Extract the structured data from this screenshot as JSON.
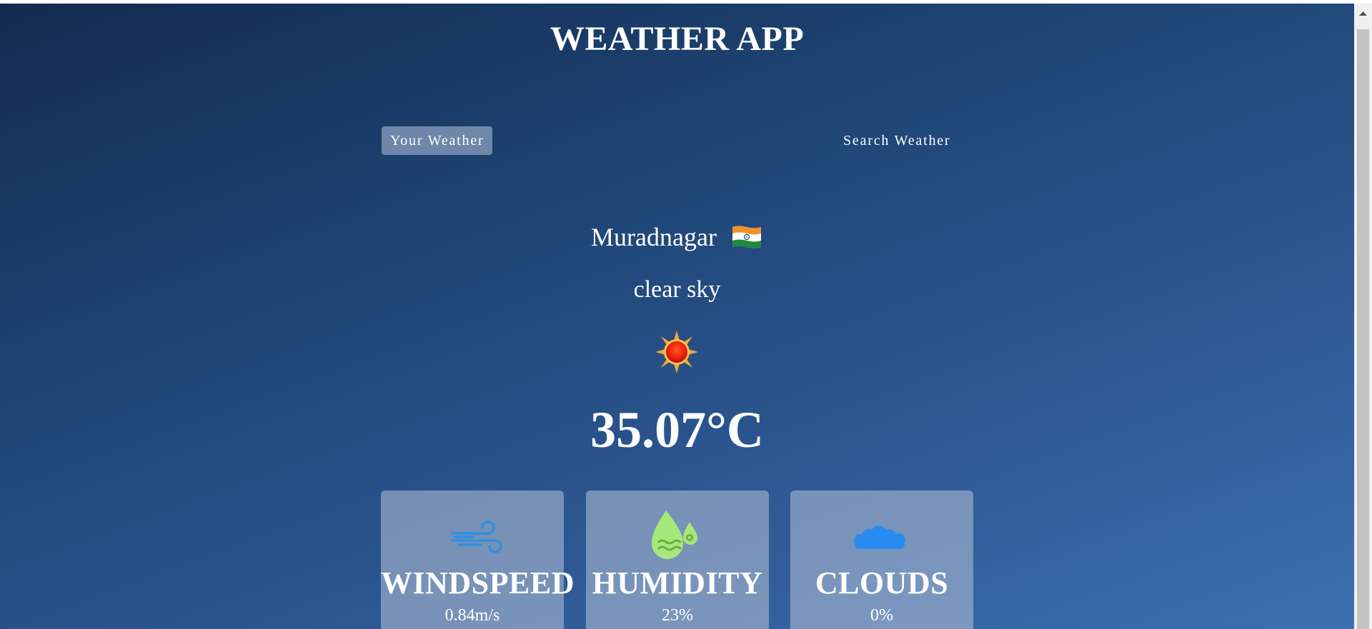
{
  "header": {
    "title": "WEATHER APP"
  },
  "tabs": [
    {
      "label": "Your Weather",
      "active": true
    },
    {
      "label": "Search Weather",
      "active": false
    }
  ],
  "weather": {
    "city": "Muradnagar",
    "country_flag": "india-flag",
    "description": "clear sky",
    "icon": "sun-icon",
    "temperature": "35.07°C"
  },
  "cards": [
    {
      "icon": "wind-icon",
      "label": "WINDSPEED",
      "value": "0.84m/s"
    },
    {
      "icon": "humidity-icon",
      "label": "HUMIDITY",
      "value": "23%"
    },
    {
      "icon": "cloud-icon",
      "label": "CLOUDS",
      "value": "0%"
    }
  ],
  "colors": {
    "background_top": "#132b50",
    "background_bottom": "#3d6fb0",
    "card_bg": "#a8b8d2",
    "wind_icon": "#2f8fe0",
    "humidity_icon": "#a6e87a",
    "cloud_icon": "#2a8cf0"
  }
}
